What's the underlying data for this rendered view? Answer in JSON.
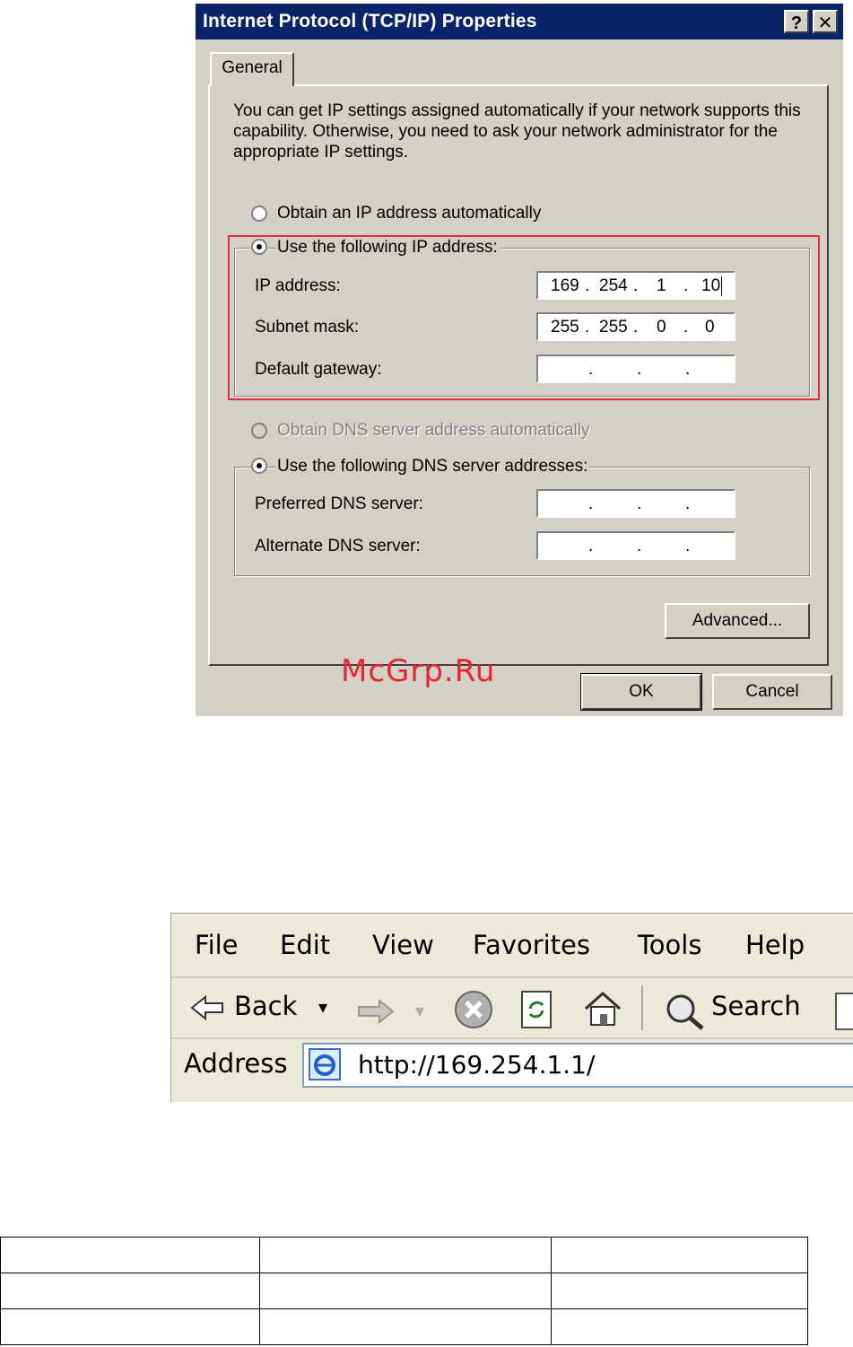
{
  "dialog": {
    "title": "Internet Protocol (TCP/IP) Properties",
    "help_button": "?",
    "close_button": "✕",
    "tab_general": "General",
    "description": "You can get IP settings assigned automatically if your network supports this capability. Otherwise, you need to ask your network administrator for the appropriate IP settings.",
    "radio_obtain_ip": "Obtain an IP address automatically",
    "radio_use_ip": "Use the following IP address:",
    "ip_label": "IP address:",
    "ip_value": [
      "169",
      "254",
      "1",
      "10"
    ],
    "subnet_label": "Subnet mask:",
    "subnet_value": [
      "255",
      "255",
      "0",
      "0"
    ],
    "gateway_label": "Default gateway:",
    "radio_obtain_dns": "Obtain DNS server address automatically",
    "radio_use_dns": "Use the following DNS server addresses:",
    "preferred_dns_label": "Preferred DNS server:",
    "alternate_dns_label": "Alternate DNS server:",
    "advanced_button": "Advanced...",
    "ok_button": "OK",
    "cancel_button": "Cancel"
  },
  "watermark": "McGrp.Ru",
  "browser": {
    "menu": [
      "File",
      "Edit",
      "View",
      "Favorites",
      "Tools",
      "Help"
    ],
    "back_label": "Back",
    "search_label": "Search",
    "address_label": "Address",
    "url": "http://169.254.1.1/"
  },
  "colors": {
    "dialog_face": "#d4d0c8",
    "titlebar": "#0a246a",
    "highlight_box": "#e03030",
    "watermark": "#e8252f",
    "browser_face": "#ece9d8"
  }
}
